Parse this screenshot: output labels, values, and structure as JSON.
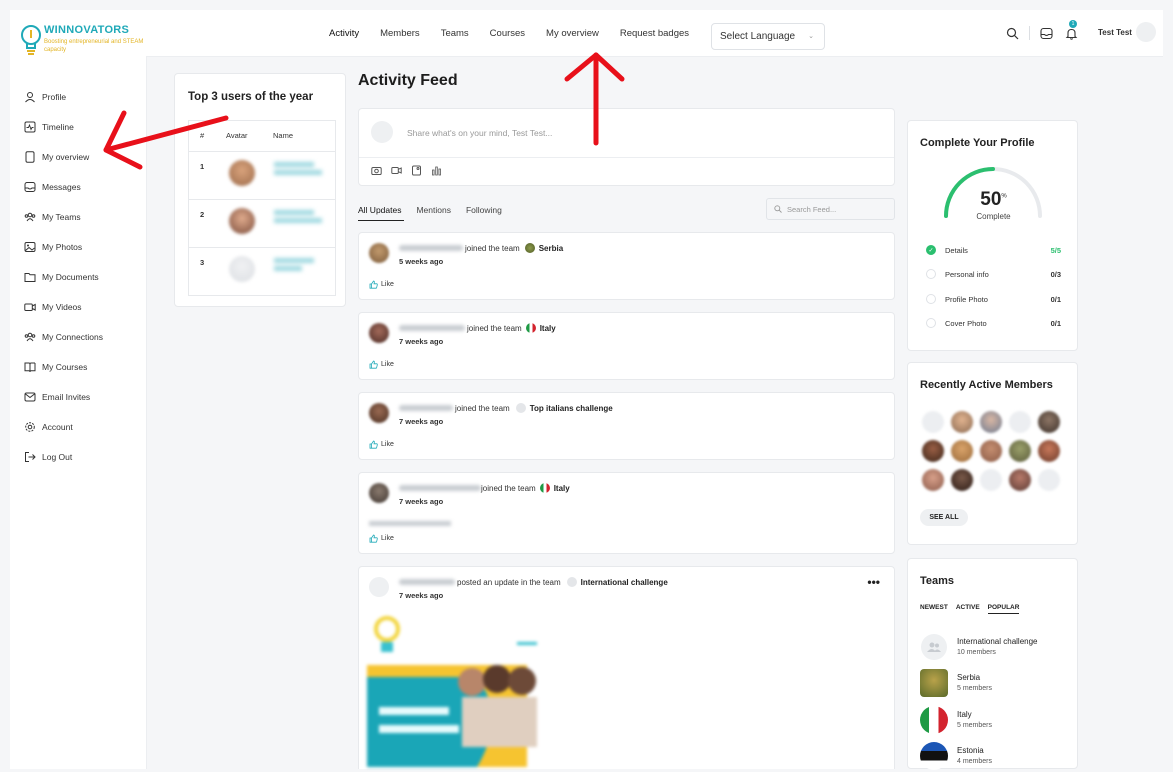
{
  "brand": {
    "name": "WINNOVATORS",
    "tagline": "Boosting entrepreneurial and STEAM capacity"
  },
  "sidebar": {
    "items": [
      {
        "label": "Profile",
        "icon": "user-icon"
      },
      {
        "label": "Timeline",
        "icon": "activity-icon"
      },
      {
        "label": "My overview",
        "icon": "document-icon"
      },
      {
        "label": "Messages",
        "icon": "inbox-icon"
      },
      {
        "label": "My Teams",
        "icon": "group-icon"
      },
      {
        "label": "My Photos",
        "icon": "photo-icon"
      },
      {
        "label": "My Documents",
        "icon": "folder-icon"
      },
      {
        "label": "My Videos",
        "icon": "video-icon"
      },
      {
        "label": "My Connections",
        "icon": "connections-icon"
      },
      {
        "label": "My Courses",
        "icon": "book-icon"
      },
      {
        "label": "Email Invites",
        "icon": "mail-icon"
      },
      {
        "label": "Account",
        "icon": "gear-icon"
      },
      {
        "label": "Log Out",
        "icon": "logout-icon"
      }
    ]
  },
  "header": {
    "nav": [
      "Activity",
      "Members",
      "Teams",
      "Courses",
      "My overview",
      "Request badges"
    ],
    "language_select": "Select Language",
    "notification_count": "1",
    "user_name": "Test Test"
  },
  "top_users": {
    "title": "Top 3 users of the year",
    "columns": [
      "#",
      "Avatar",
      "Name"
    ],
    "ranks": [
      "1",
      "2",
      "3"
    ]
  },
  "feed": {
    "title": "Activity Feed",
    "placeholder": "Share what's on your mind, Test Test...",
    "tabs": [
      "All Updates",
      "Mentions",
      "Following"
    ],
    "search_placeholder": "Search Feed...",
    "like_label": "Like",
    "items": [
      {
        "action": "joined the team",
        "team": "Serbia",
        "time": "5 weeks ago"
      },
      {
        "action": "joined the team",
        "team": "Italy",
        "time": "7 weeks ago"
      },
      {
        "action": "joined the team",
        "team": "Top italians challenge",
        "time": "7 weeks ago"
      },
      {
        "action": "joined the team",
        "team": "Italy",
        "time": "7 weeks ago"
      },
      {
        "action": "posted an update in the team",
        "team": "International challenge",
        "time": "7 weeks ago"
      }
    ]
  },
  "profile_completion": {
    "title": "Complete Your Profile",
    "percent": "50",
    "percent_unit": "%",
    "percent_label": "Complete",
    "items": [
      {
        "label": "Details",
        "count": "5/5",
        "done": true
      },
      {
        "label": "Personal info",
        "count": "0/3",
        "done": false
      },
      {
        "label": "Profile Photo",
        "count": "0/1",
        "done": false
      },
      {
        "label": "Cover Photo",
        "count": "0/1",
        "done": false
      }
    ]
  },
  "recent_members": {
    "title": "Recently Active Members",
    "see_all": "SEE ALL"
  },
  "teams": {
    "title": "Teams",
    "tabs": [
      "NEWEST",
      "ACTIVE",
      "POPULAR"
    ],
    "list": [
      {
        "name": "International challenge",
        "members": "10 members"
      },
      {
        "name": "Serbia",
        "members": "5 members"
      },
      {
        "name": "Italy",
        "members": "5 members"
      },
      {
        "name": "Estonia",
        "members": "4 members"
      }
    ]
  },
  "colors": {
    "accent": "#1fa9b8",
    "success": "#2bbf6f",
    "arrow": "#e8101a"
  }
}
